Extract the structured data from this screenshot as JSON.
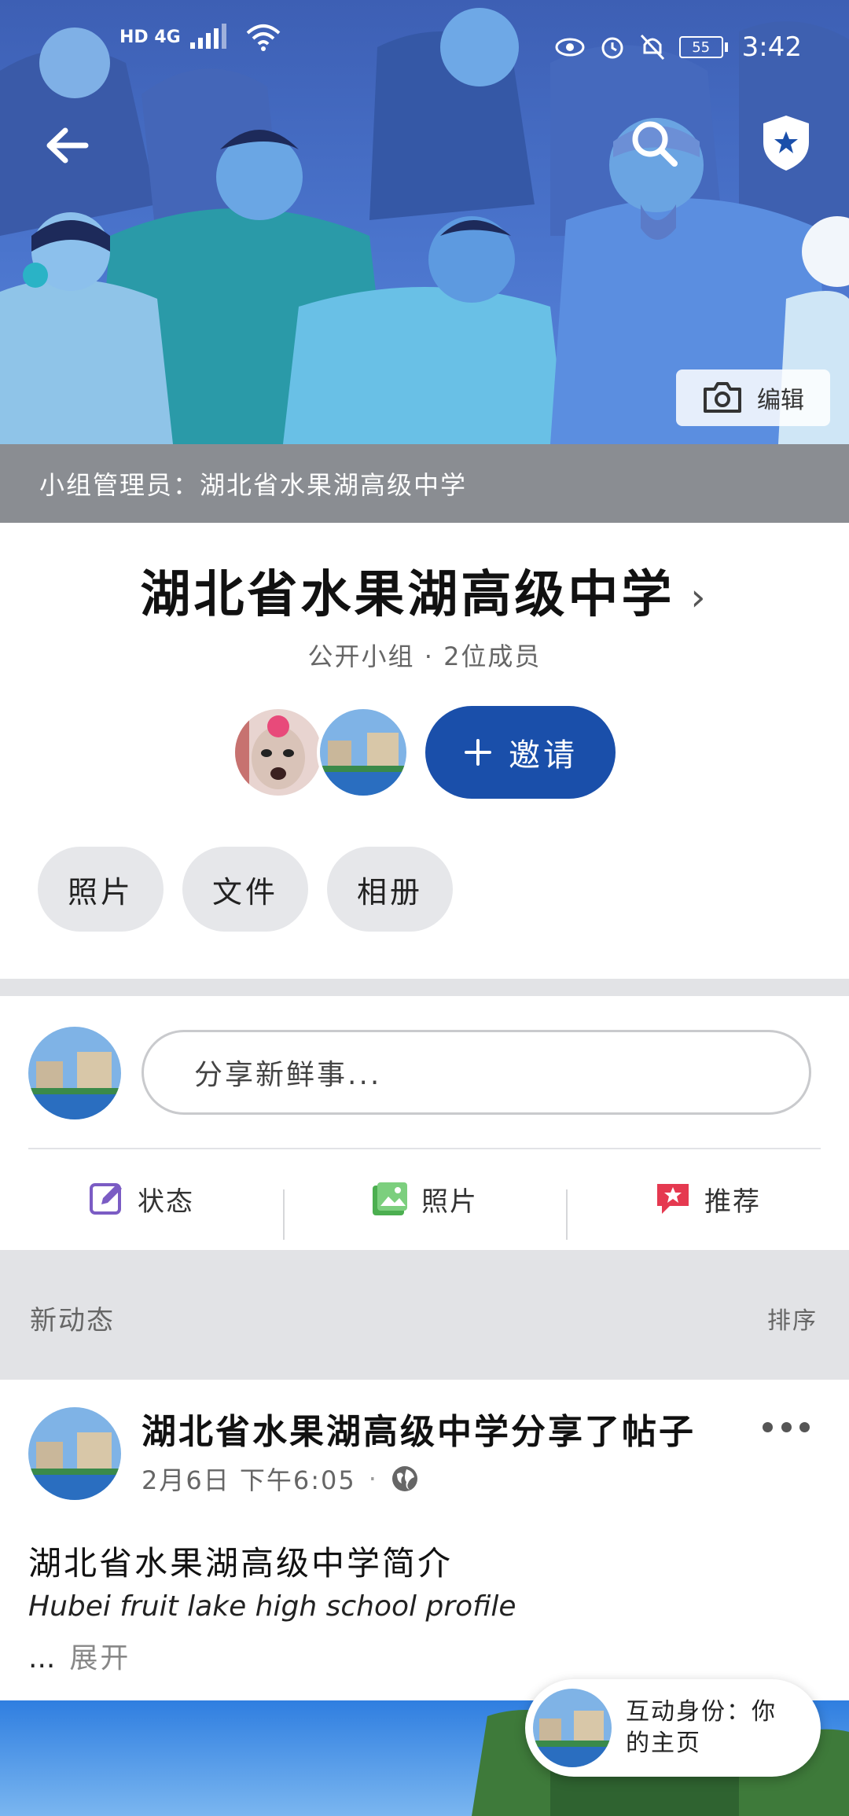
{
  "status_bar": {
    "network": "HD 4G",
    "time": "3:42",
    "battery": "55"
  },
  "cover": {
    "edit_label": "编辑"
  },
  "admin_band": {
    "text": "小组管理员：湖北省水果湖高级中学"
  },
  "group": {
    "title": "湖北省水果湖高级中学",
    "meta": "公开小组 · 2位成员",
    "invite_label": "邀请"
  },
  "chips": [
    {
      "label": "照片"
    },
    {
      "label": "文件"
    },
    {
      "label": "相册"
    }
  ],
  "composer": {
    "placeholder": "分享新鲜事...",
    "actions": [
      {
        "label": "状态",
        "icon": "edit-icon",
        "color": "#7b5cc4"
      },
      {
        "label": "照片",
        "icon": "photo-icon",
        "color": "#4caf50"
      },
      {
        "label": "推荐",
        "icon": "recommend-icon",
        "color": "#e53950"
      }
    ]
  },
  "feed": {
    "title": "新动态",
    "sort_label": "排序"
  },
  "post": {
    "author": "湖北省水果湖高级中学分享了帖子",
    "time": "2月6日 下午6:05",
    "title": "湖北省水果湖高级中学简介",
    "subtitle": "Hubei fruit lake high school profile",
    "ellipsis": "...",
    "expand_label": "展开"
  },
  "identity_pill": {
    "text": "互动身份：你的主页"
  },
  "colors": {
    "primary": "#1a4faa",
    "band": "#e2e3e6",
    "admin_band": "#8a8d92"
  }
}
